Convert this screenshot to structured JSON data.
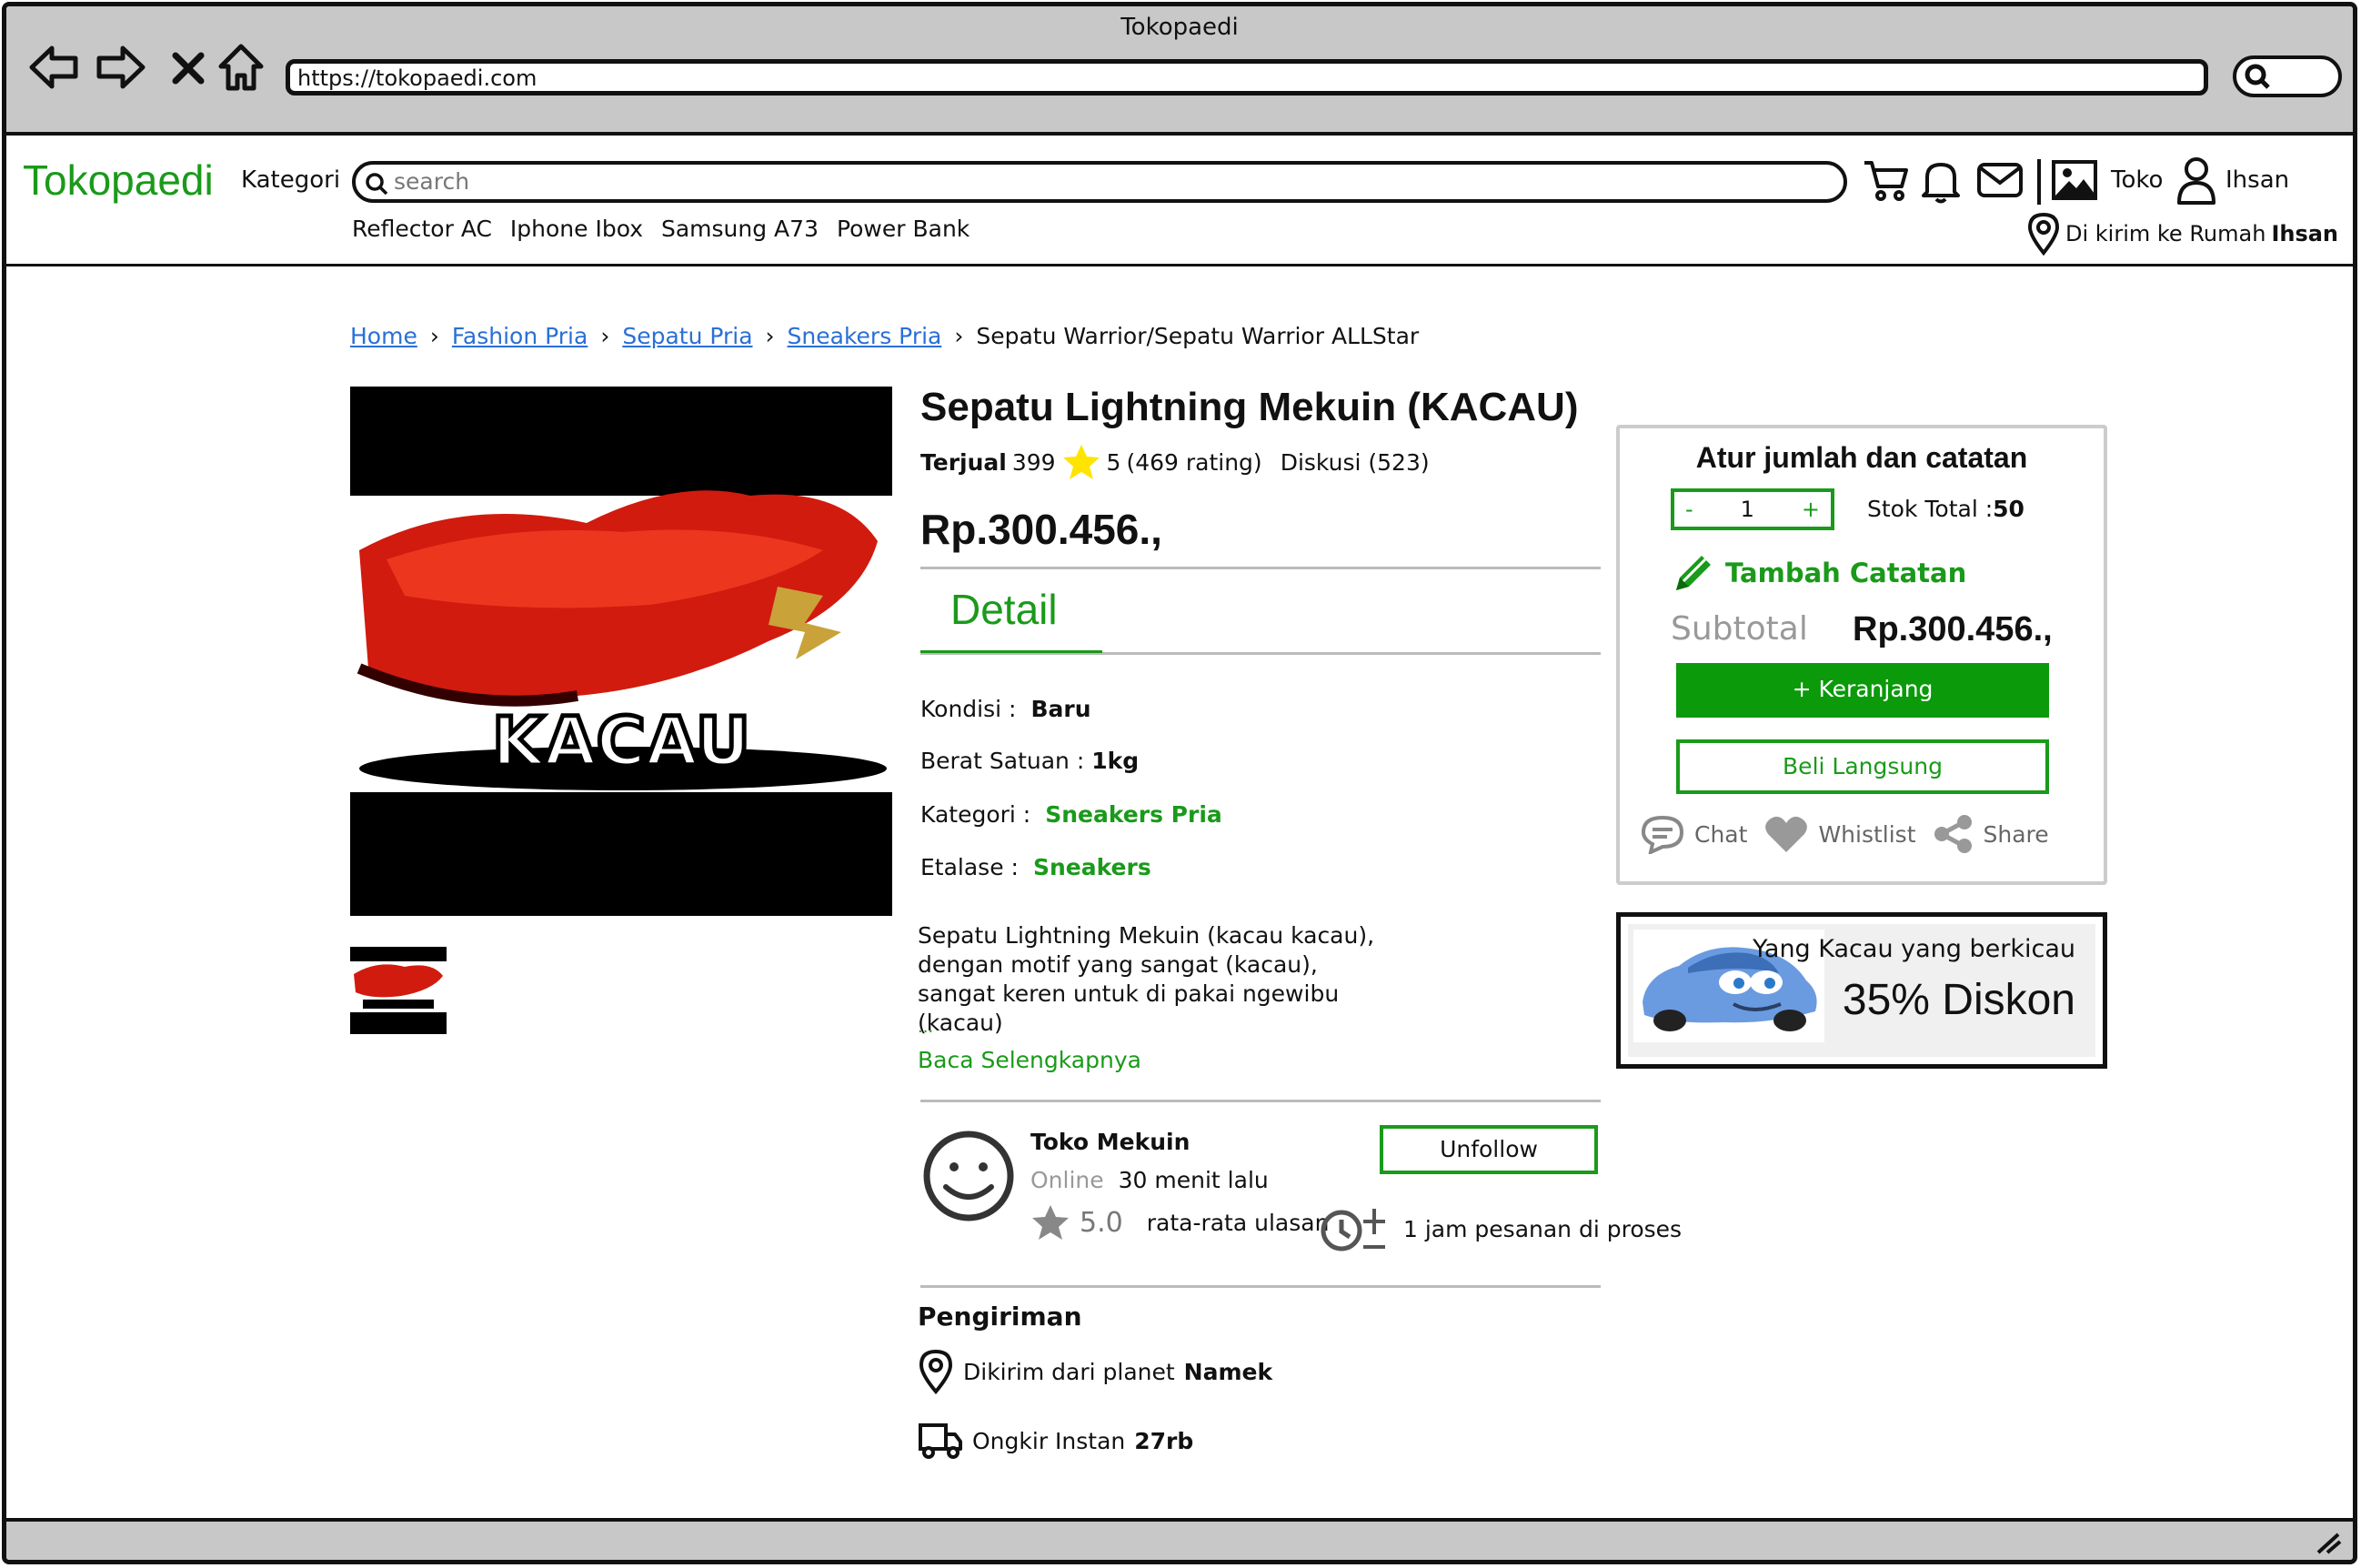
{
  "browser": {
    "window_title": "Tokopaedi",
    "url": "https://tokopaedi.com"
  },
  "header": {
    "logo": "Tokopaedi",
    "kategori": "Kategori",
    "search_placeholder": "search",
    "quick_links": [
      "Reflector AC",
      "Iphone Ibox",
      "Samsung A73",
      "Power Bank"
    ],
    "toko_label": "Toko",
    "user_label": "Ihsan",
    "delivery_prefix": "Di kirim ke Rumah",
    "delivery_name": "Ihsan"
  },
  "breadcrumb": {
    "items": [
      "Home",
      "Fashion Pria",
      "Sepatu Pria",
      "Sneakers Pria"
    ],
    "current": "Sepatu Warrior/Sepatu Warrior ALLStar"
  },
  "product": {
    "image_caption": "KACAU",
    "title": "Sepatu Lightning Mekuin (KACAU)",
    "sold_label": "Terjual",
    "sold_count": "399",
    "rating": "5",
    "rating_count": "(469 rating)",
    "discussion": "Diskusi (523)",
    "price": "Rp.300.456.,",
    "detail_tab": "Detail",
    "specs": {
      "kondisi_label": "Kondisi :",
      "kondisi_value": "Baru",
      "berat_label": "Berat Satuan :",
      "berat_value": "1kg",
      "kategori_label": "Kategori :",
      "kategori_value": "Sneakers Pria",
      "etalase_label": "Etalase :",
      "etalase_value": "Sneakers"
    },
    "description": "Sepatu Lightning Mekuin (kacau kacau), dengan motif yang sangat (kacau), sangat keren untuk di pakai ngewibu (kacau)",
    "ellipsis": "...",
    "read_more": "Baca Selengkapnya"
  },
  "shop": {
    "name": "Toko Mekuin",
    "online_label": "Online",
    "online_time": "30 menit lalu",
    "rating_value": "5.0",
    "rating_label": "rata-rata ulasan",
    "process_label": "1 jam pesanan di proses",
    "unfollow_label": "Unfollow"
  },
  "shipping": {
    "title": "Pengiriman",
    "from_label": "Dikirim dari planet",
    "from_value": "Namek",
    "cost_label": "Ongkir Instan",
    "cost_value": "27rb"
  },
  "cart": {
    "title": "Atur jumlah dan catatan",
    "minus": "-",
    "quantity": "1",
    "plus": "+",
    "stock_label": "Stok Total :",
    "stock_value": "50",
    "add_note": "Tambah Catatan",
    "subtotal_label": "Subtotal",
    "subtotal_value": "Rp.300.456.,",
    "add_to_cart": "+ Keranjang",
    "buy_now": "Beli Langsung",
    "chat": "Chat",
    "wishlist": "Whistlist",
    "share": "Share"
  },
  "promo": {
    "subtitle": "Yang Kacau yang berkicau",
    "headline": "35% Diskon"
  },
  "colors": {
    "brand_green": "#1a9a1a",
    "link_blue": "#2a6fd6",
    "chrome_gray": "#c8c8c8"
  }
}
